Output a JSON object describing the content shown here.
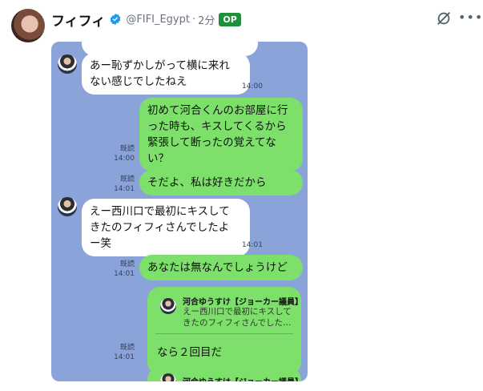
{
  "post": {
    "author_name": "フィフィ",
    "handle": "@FIFI_Egypt",
    "separator": "·",
    "time": "2分",
    "badge": "OP"
  },
  "icons": [
    "verified-badge-icon",
    "hide-icon",
    "more-icon",
    "avatar"
  ],
  "chat": {
    "top_time": "14:00",
    "messages": [
      {
        "side": "left",
        "text": "あー恥ずかしがって横に来れ\nない感じでしたねえ",
        "time": "14:00"
      },
      {
        "side": "right",
        "text": "初めて河合くんのお部屋に行\nった時も、キスしてくるから\n緊張して断ったの覚えてな\nい？",
        "read": "既読",
        "time": "14:00"
      },
      {
        "side": "right",
        "text": "そだよ、私は好きだから",
        "read": "既読",
        "time": "14:01"
      },
      {
        "side": "left",
        "text": "えー西川口で最初にキスして\nきたのフィフィさんでしたよ\nー笑",
        "time": "14:01"
      },
      {
        "side": "right",
        "text": "あなたは無なんでしょうけど",
        "read": "既読",
        "time": "14:01"
      }
    ],
    "reply": {
      "quoted_name": "河合ゆうすけ【ジョーカー議員】",
      "quoted_text": "えー西川口で最初にキスして\nきたのフィフィさんでした…",
      "message": "なら２回目だ",
      "read": "既読",
      "time": "14:01"
    },
    "reply2": {
      "quoted_name": "河合ゆうすけ【ジョーカー議員】"
    }
  }
}
